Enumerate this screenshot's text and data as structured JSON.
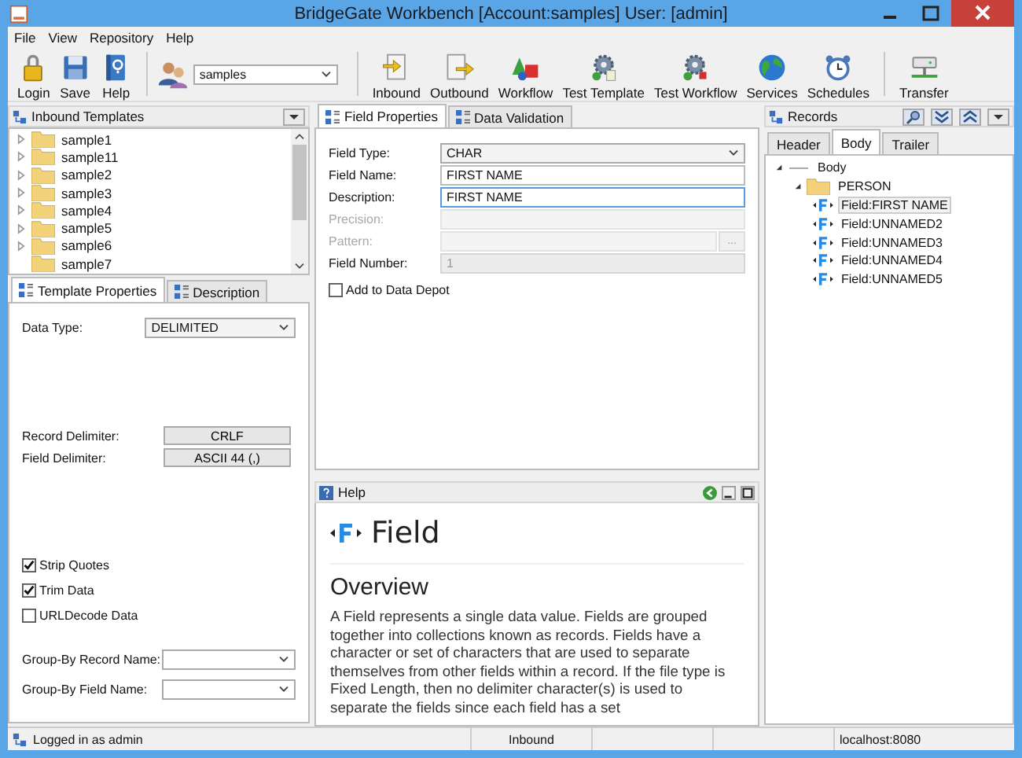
{
  "window": {
    "title": "BridgeGate Workbench [Account:samples] User: [admin]"
  },
  "menu": [
    "File",
    "View",
    "Repository",
    "Help"
  ],
  "toolbar": {
    "file_buttons": [
      "Login",
      "Save",
      "Help"
    ],
    "account": "samples",
    "action_buttons": [
      "Inbound",
      "Outbound",
      "Workflow",
      "Test Template",
      "Test Workflow",
      "Services",
      "Schedules"
    ],
    "transfer_button": "Transfer"
  },
  "templates": {
    "title": "Inbound Templates",
    "items": [
      {
        "label": "sample1",
        "has_children": true
      },
      {
        "label": "sample11",
        "has_children": true
      },
      {
        "label": "sample2",
        "has_children": true
      },
      {
        "label": "sample3",
        "has_children": true
      },
      {
        "label": "sample4",
        "has_children": true
      },
      {
        "label": "sample5",
        "has_children": true
      },
      {
        "label": "sample6",
        "has_children": true
      },
      {
        "label": "sample7",
        "has_children": false
      }
    ]
  },
  "template_tabs": [
    {
      "label": "Template Properties",
      "selected": true
    },
    {
      "label": "Description",
      "selected": false
    }
  ],
  "template_properties": {
    "data_type": {
      "label": "Data Type:",
      "value": "DELIMITED"
    },
    "record_delimiter": {
      "label": "Record Delimiter:",
      "value": "CRLF"
    },
    "field_delimiter": {
      "label": "Field Delimiter:",
      "value": "ASCII 44 (,)"
    },
    "options": [
      {
        "label": "Strip Quotes",
        "checked": true
      },
      {
        "label": "Trim Data",
        "checked": true
      },
      {
        "label": "URLDecode Data",
        "checked": false
      }
    ],
    "group_by": [
      {
        "label": "Group-By Record Name:"
      },
      {
        "label": "Group-By Field Name:"
      }
    ]
  },
  "field_tabs": [
    {
      "label": "Field Properties",
      "selected": true
    },
    {
      "label": "Data Validation",
      "selected": false
    }
  ],
  "field_properties": {
    "rows": [
      {
        "label": "Field Type:",
        "kind": "select",
        "value": "CHAR",
        "disabled": false,
        "readonly": false,
        "focused": false
      },
      {
        "label": "Field Name:",
        "kind": "text",
        "value": "FIRST NAME",
        "disabled": false,
        "readonly": false,
        "focused": false
      },
      {
        "label": "Description:",
        "kind": "text",
        "value": "FIRST NAME",
        "disabled": false,
        "readonly": false,
        "focused": true
      },
      {
        "label": "Precision:",
        "kind": "text",
        "disabled": true,
        "readonly": false,
        "focused": false
      },
      {
        "label": "Pattern:",
        "kind": "browse",
        "button": "...",
        "disabled": true,
        "readonly": false,
        "focused": false
      },
      {
        "label": "Field Number:",
        "kind": "text",
        "value": "1",
        "disabled": false,
        "readonly": true,
        "focused": false
      }
    ],
    "data_depot": {
      "label": "Add to Data Depot",
      "checked": false
    }
  },
  "help": {
    "title": "Help",
    "heading": "Field",
    "section": "Overview",
    "paragraph": "A Field represents a single data value. Fields are grouped together into collections known as records. Fields have a character or set of characters that are used to separate themselves from other fields within a record. If the file type is Fixed Length, then no delimiter character(s) is used to separate the fields since each field has a set"
  },
  "records": {
    "title": "Records",
    "tabs": [
      {
        "label": "Header",
        "selected": false
      },
      {
        "label": "Body",
        "selected": true
      },
      {
        "label": "Trailer",
        "selected": false
      }
    ],
    "tree": [
      {
        "label": "Body",
        "kind": "section",
        "expanded": true,
        "selected": false,
        "children": [
          {
            "label": "PERSON",
            "kind": "record",
            "expanded": true,
            "selected": false,
            "children": [
              {
                "label": "Field:FIRST NAME",
                "kind": "field",
                "selected": true
              },
              {
                "label": "Field:UNNAMED2",
                "kind": "field",
                "selected": false
              },
              {
                "label": "Field:UNNAMED3",
                "kind": "field",
                "selected": false
              },
              {
                "label": "Field:UNNAMED4",
                "kind": "field",
                "selected": false
              },
              {
                "label": "Field:UNNAMED5",
                "kind": "field",
                "selected": false
              }
            ]
          }
        ]
      }
    ]
  },
  "status_bar": {
    "message": "Logged in as admin",
    "mode": "Inbound",
    "server": "localhost:8080"
  }
}
